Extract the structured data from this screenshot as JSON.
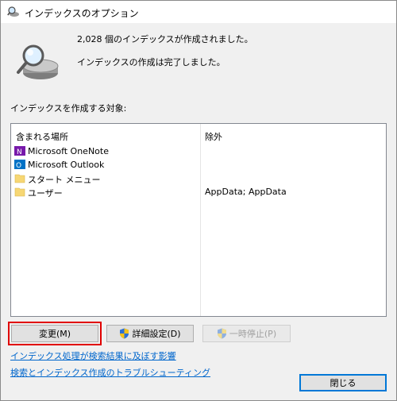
{
  "window": {
    "title": "インデックスのオプション"
  },
  "status": {
    "indexed_count_text": "2,028 個のインデックスが作成されました。",
    "complete_text": "インデックスの作成は完了しました。"
  },
  "locations": {
    "section_label": "インデックスを作成する対象:",
    "column_included": "含まれる場所",
    "column_excluded": "除外",
    "rows": [
      {
        "label": "Microsoft OneNote",
        "icon": "onenote-icon",
        "excluded": ""
      },
      {
        "label": "Microsoft Outlook",
        "icon": "outlook-icon",
        "excluded": ""
      },
      {
        "label": "スタート メニュー",
        "icon": "folder-icon",
        "excluded": ""
      },
      {
        "label": "ユーザー",
        "icon": "folder-icon",
        "excluded": "AppData; AppData"
      }
    ]
  },
  "buttons": {
    "modify": "変更(M)",
    "advanced": "詳細設定(D)",
    "pause": "一時停止(P)",
    "close": "閉じる"
  },
  "links": {
    "effect": "インデックス処理が検索結果に及ぼす影響",
    "troubleshoot": "検索とインデックス作成のトラブルシューティング"
  },
  "colors": {
    "highlight": "#e00000",
    "link": "#0066cc",
    "onenote": "#7719aa",
    "outlook": "#0072c6",
    "folder": "#f7d774"
  }
}
